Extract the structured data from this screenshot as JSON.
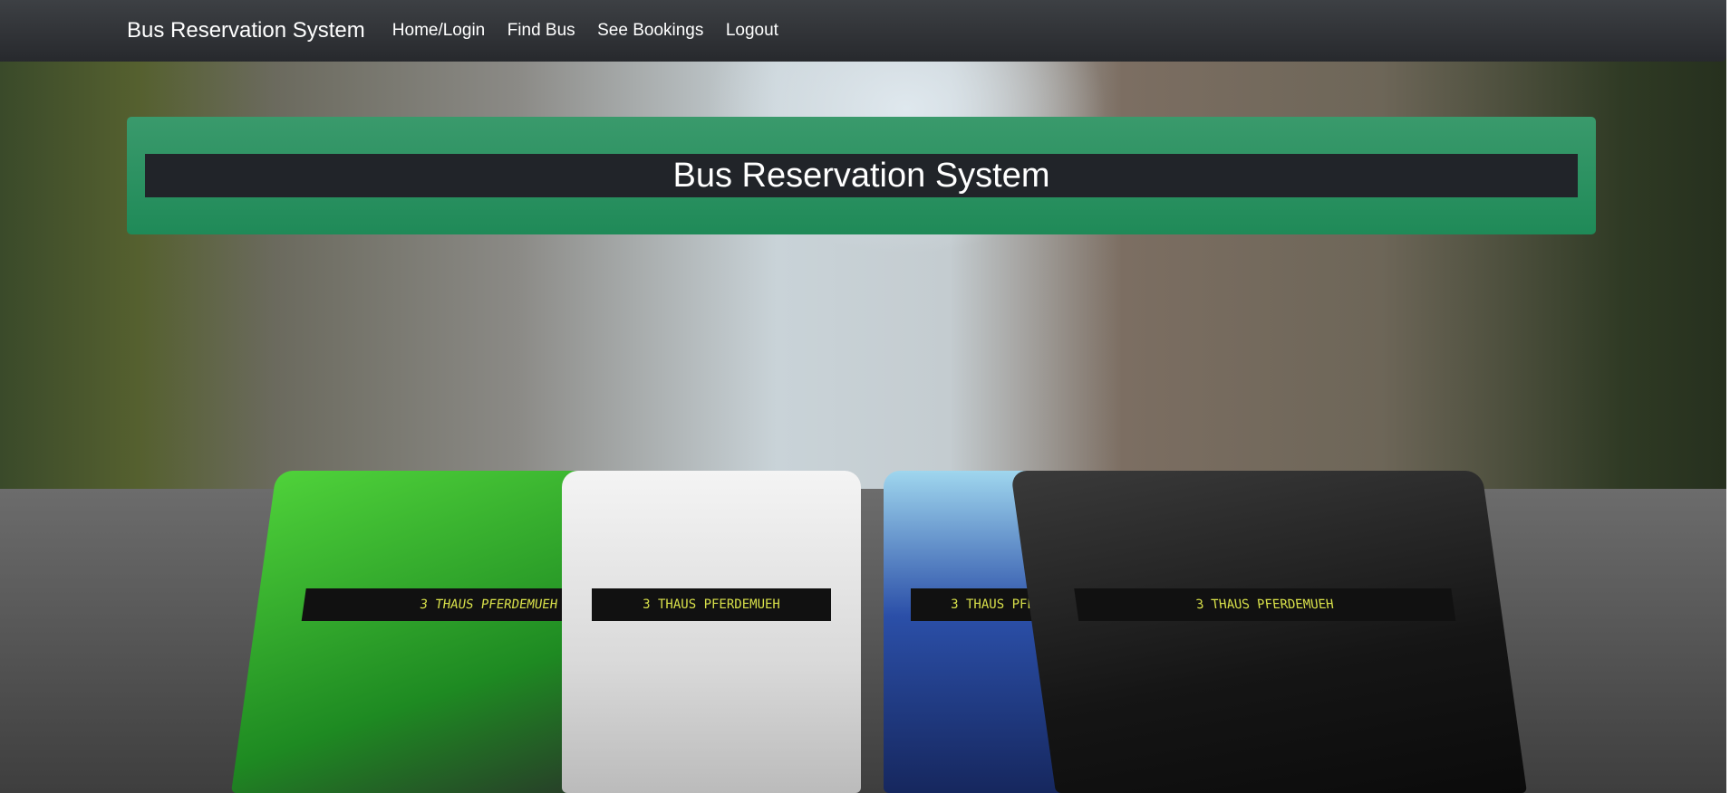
{
  "navbar": {
    "brand": "Bus Reservation System",
    "links": [
      "Home/Login",
      "Find Bus",
      "See Bookings",
      "Logout"
    ]
  },
  "hero": {
    "title": "Bus Reservation System",
    "bus_signs": [
      "3 THAUS PFERDEMUEH",
      "3 THAUS PFERDEMUEH",
      "3 THAUS PFERDEMUEH",
      "3 THAUS PFERDEMUEH"
    ]
  },
  "colors": {
    "navbar": "#2b2e32",
    "jumbotron": "#2a9463",
    "title_bar": "#212429"
  }
}
